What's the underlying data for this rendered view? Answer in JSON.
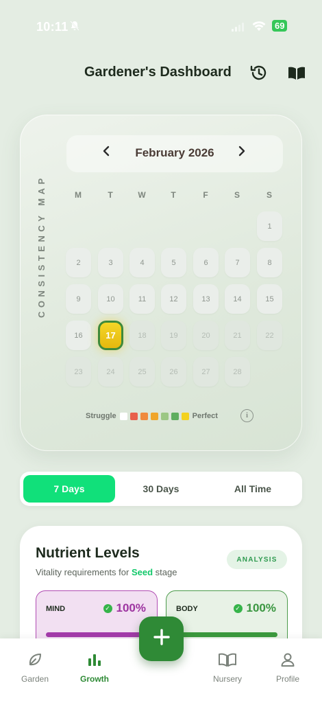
{
  "status_bar": {
    "time": "10:11",
    "battery": "69"
  },
  "header": {
    "title": "Gardener's Dashboard",
    "history_icon": "history-icon",
    "journal_icon": "book-open-icon"
  },
  "calendar": {
    "side_label": "CONSISTENCY MAP",
    "month": "February 2026",
    "prev_icon": "chevron-left-icon",
    "next_icon": "chevron-right-icon",
    "weekdays": [
      "M",
      "T",
      "W",
      "T",
      "F",
      "S",
      "S"
    ],
    "days": [
      "1",
      "2",
      "3",
      "4",
      "5",
      "6",
      "7",
      "8",
      "9",
      "10",
      "11",
      "12",
      "13",
      "14",
      "15",
      "16",
      "17",
      "18",
      "19",
      "20",
      "21",
      "22",
      "23",
      "24",
      "25",
      "26",
      "27",
      "28"
    ],
    "today": "17",
    "legend": {
      "low": "Struggle",
      "high": "Perfect",
      "colors": [
        "#ffffff",
        "#e8604c",
        "#f08a3e",
        "#f0a52a",
        "#9cc784",
        "#5fae5f",
        "#f3d21f"
      ]
    }
  },
  "range_tabs": {
    "tabs": [
      "7 Days",
      "30 Days",
      "All Time"
    ],
    "active": "7 Days",
    "accent": "#11e07a"
  },
  "nutrients": {
    "title": "Nutrient Levels",
    "subtitle_prefix": "Vitality requirements for",
    "stage": "Seed",
    "subtitle_suffix": "stage",
    "analysis_label": "ANALYSIS",
    "mind": {
      "label": "MIND",
      "value": "100%",
      "level": 1.0,
      "color": "#a43bab"
    },
    "body": {
      "label": "BODY",
      "value": "100%",
      "level": 1.0,
      "color": "#3c9a3e"
    }
  },
  "bottom_nav": {
    "items": [
      {
        "label": "Garden",
        "icon": "leaf-icon"
      },
      {
        "label": "Growth",
        "icon": "bar-chart-icon"
      },
      {
        "label": "Nursery",
        "icon": "book-open-icon"
      },
      {
        "label": "Profile",
        "icon": "user-icon"
      }
    ],
    "active": "Growth",
    "fab_icon": "plus-icon"
  }
}
